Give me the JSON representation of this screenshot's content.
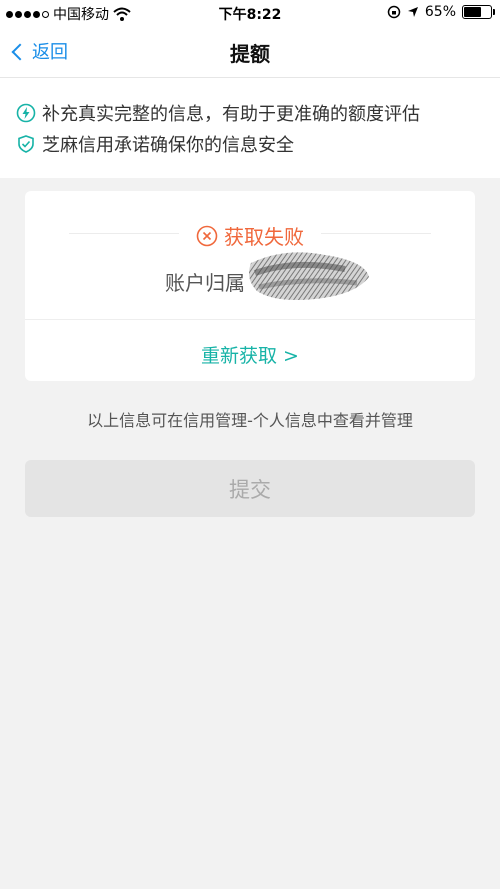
{
  "status_bar": {
    "carrier": "中国移动",
    "time": "下午8:22",
    "battery_percent": "65%",
    "battery_level": 0.65,
    "signal_filled": 4,
    "signal_total": 5
  },
  "nav": {
    "back_label": "返回",
    "title": "提额"
  },
  "tips": {
    "items": [
      {
        "icon": "lightning-icon",
        "text": "补充真实完整的信息，有助于更准确的额度评估"
      },
      {
        "icon": "shield-icon",
        "text": "芝麻信用承诺确保你的信息安全"
      }
    ]
  },
  "card": {
    "fail_text": "获取失败",
    "account_label": "账户归属",
    "retry_label": "重新获取 >"
  },
  "info_note": "以上信息可在信用管理-个人信息中查看并管理",
  "submit_label": "提交",
  "colors": {
    "accent_blue": "#1a8ee8",
    "teal": "#17b3a7",
    "fail_orange": "#f0683c"
  }
}
